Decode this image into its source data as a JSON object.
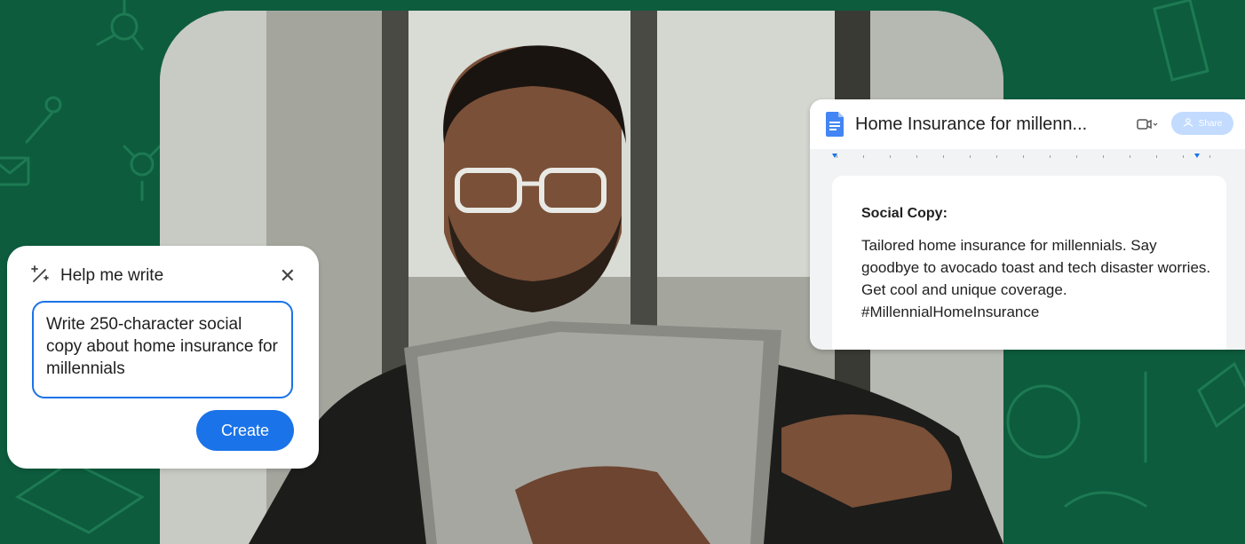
{
  "help_me_write": {
    "title": "Help me write",
    "close_symbol": "✕",
    "prompt_text": "Write 250-character social copy about home insurance for millennials",
    "create_label": "Create"
  },
  "doc": {
    "title": "Home Insurance for millenn...",
    "share_label": "Share",
    "heading": "Social Copy:",
    "body": "Tailored home insurance for millennials. Say goodbye to avocado toast and tech disaster worries. Get cool and unique coverage. #MillennialHomeInsurance"
  },
  "icons": [
    "sparkle-pencil-icon",
    "close-icon",
    "docs-icon",
    "video-icon",
    "person-icon"
  ],
  "colors": {
    "background": "#0d5c3e",
    "accent": "#1a73e8",
    "share": "#c2dbff"
  }
}
